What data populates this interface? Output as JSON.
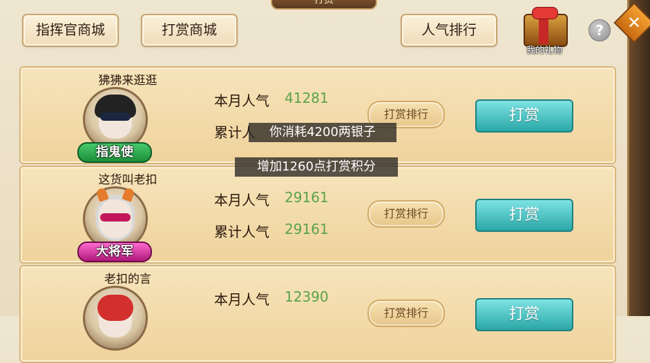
{
  "header": {
    "title": "打赏",
    "commander_shop_label": "指挥官商城",
    "reward_shop_label": "打赏商城",
    "popularity_rank_label": "人气排行",
    "my_gifts_label": "我的礼物",
    "help_label": "?",
    "close_label": "✕"
  },
  "players": [
    {
      "name": "狒狒来逛逛",
      "title_badge": "指鬼使",
      "monthly_label": "本月人气",
      "monthly_value": "41281",
      "total_label": "累计人",
      "rank_button": "打赏排行",
      "reward_button": "打赏"
    },
    {
      "name": "这货叫老扣",
      "title_badge": "大将军",
      "monthly_label": "本月人气",
      "monthly_value": "29161",
      "total_label": "累计人气",
      "total_value": "29161",
      "rank_button": "打赏排行",
      "reward_button": "打赏"
    },
    {
      "name": "老扣的言",
      "monthly_label": "本月人气",
      "monthly_value": "12390",
      "rank_button": "打赏排行",
      "reward_button": "打赏"
    }
  ],
  "toasts": {
    "line1": "你消耗4200两银子",
    "line2": "增加1260点打赏积分"
  },
  "colors": {
    "value_green": "#5aa24a",
    "reward_teal": "#2aa7a7",
    "card_bg": "#f6e4bb"
  }
}
